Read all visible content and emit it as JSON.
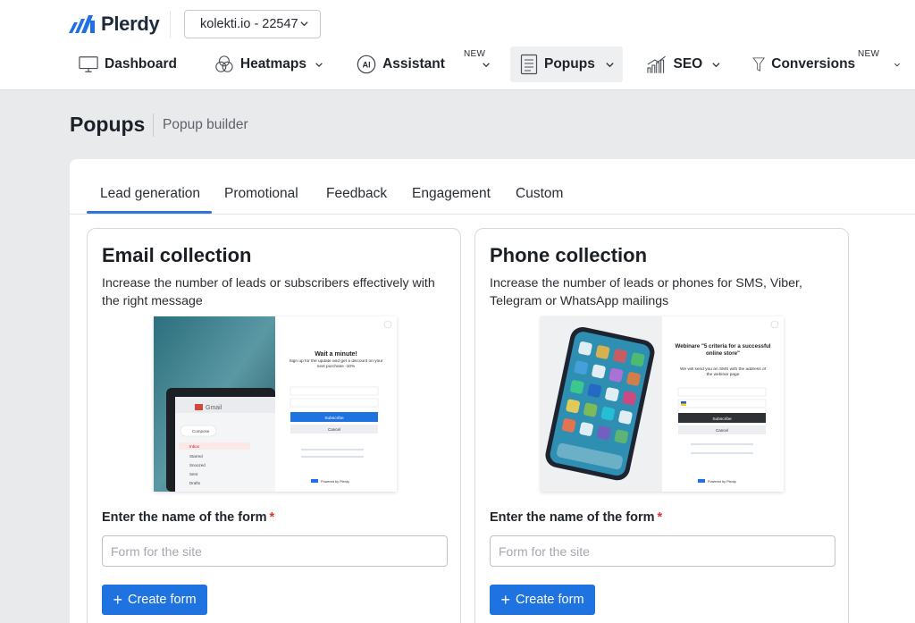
{
  "header": {
    "logo_text": "Plerdy",
    "site_select": "kolekti.io - 22547",
    "nav": [
      {
        "label": "Dashboard",
        "icon": "monitor-icon"
      },
      {
        "label": "Heatmaps",
        "icon": "heatmap-circles-icon"
      },
      {
        "label": "Assistant",
        "icon": "ai-icon",
        "icon_text": "AI",
        "badge": "NEW"
      },
      {
        "label": "Popups",
        "icon": "document-icon",
        "active": true
      },
      {
        "label": "SEO",
        "icon": "bar-chart-icon"
      },
      {
        "label": "Conversions",
        "icon": "funnel-icon",
        "badge": "NEW"
      }
    ]
  },
  "page": {
    "title": "Popups",
    "subtitle": "Popup builder"
  },
  "tabs": [
    "Lead generation",
    "Promotional",
    "Feedback",
    "Engagement",
    "Custom"
  ],
  "active_tab": "Lead generation",
  "cards": [
    {
      "title": "Email collection",
      "description": "Increase the number of leads or subscribers effectively with the right message",
      "preview": {
        "popup_title": "Wait a minute!",
        "popup_text": "Sign up for the update and get a discount on your next purchase -10%",
        "button": "Subscribe",
        "cancel": "Cancel",
        "gmail": "Gmail",
        "compose": "Compose",
        "inbox": "Inbox",
        "starred": "Starred",
        "snoozed": "Snoozed",
        "sent": "Sent",
        "drafts": "Drafts",
        "powered": "Powered by Plerdy"
      },
      "field_label": "Enter the name of the form",
      "required_mark": "*",
      "input_placeholder": "Form for the site",
      "button_label": "Create form"
    },
    {
      "title": "Phone collection",
      "description": "Increase the number of leads or phones for SMS, Viber, Telegram or WhatsApp mailings",
      "preview": {
        "popup_title": "Webinare \"5 criteria for a successful online store\"",
        "popup_text": "We will send you an SMS with the address of the webinar page",
        "button": "Subscribe",
        "cancel": "Cancel",
        "powered": "Powered by Plerdy"
      },
      "field_label": "Enter the name of the form",
      "required_mark": "*",
      "input_placeholder": "Form for the site",
      "button_label": "Create form"
    }
  ],
  "colors": {
    "accent": "#1f73e0",
    "tab_underline": "#2f74d8",
    "required": "#e0332d",
    "logo_blue": "#1f6fe5",
    "page_bg": "#e9eaec"
  }
}
